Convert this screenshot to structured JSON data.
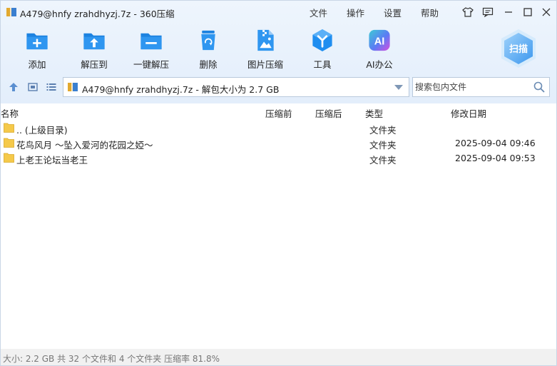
{
  "titlebar": {
    "title": "A479@hnfy zrahdhyzj.7z - 360压缩",
    "menu": [
      "文件",
      "操作",
      "设置",
      "帮助"
    ]
  },
  "toolbar": {
    "items": [
      {
        "label": "添加",
        "icon": "add-archive-icon"
      },
      {
        "label": "解压到",
        "icon": "extract-to-icon"
      },
      {
        "label": "一键解压",
        "icon": "one-click-extract-icon"
      },
      {
        "label": "删除",
        "icon": "recycle-bin-icon"
      },
      {
        "label": "图片压缩",
        "icon": "image-compress-icon"
      },
      {
        "label": "工具",
        "icon": "tools-icon"
      },
      {
        "label": "AI办公",
        "icon": "ai-office-icon"
      }
    ],
    "scan_label": "扫描"
  },
  "address": {
    "path": "A479@hnfy zrahdhyzj.7z - 解包大小为 2.7 GB"
  },
  "search": {
    "placeholder": "搜索包内文件"
  },
  "columns": [
    "名称",
    "压缩前",
    "压缩后",
    "类型",
    "修改日期"
  ],
  "files": [
    {
      "name": ".. (上级目录)",
      "type": "文件夹",
      "modified": ""
    },
    {
      "name": "花鸟风月 ～坠入爱河的花园之婭～",
      "type": "文件夹",
      "modified": "2025-09-04 09:46"
    },
    {
      "name": "上老王论坛当老王",
      "type": "文件夹",
      "modified": "2025-09-04 09:53"
    }
  ],
  "status": {
    "text": "大小: 2.2 GB 共 32 个文件和 4 个文件夹 压缩率 81.8%"
  },
  "colors": {
    "accent": "#2a8be0",
    "toolbar_bg": "#e6f0fb",
    "folder": "#f5c94a"
  }
}
